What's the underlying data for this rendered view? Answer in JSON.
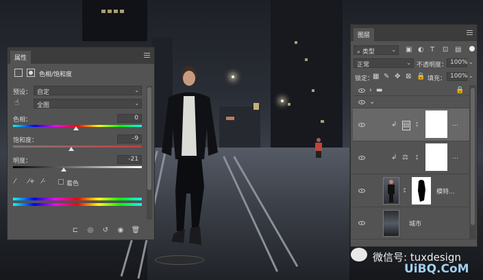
{
  "properties_panel": {
    "tab": "属性",
    "adjustment_title": "色相/饱和度",
    "preset_label": "预设：",
    "preset_value": "自定",
    "channel_value": "全图",
    "hue_label": "色相：",
    "hue_value": "0",
    "saturation_label": "饱和度：",
    "saturation_value": "-9",
    "lightness_label": "明度：",
    "lightness_value": "-21",
    "colorize_label": "着色"
  },
  "layers_panel": {
    "tab": "图层",
    "filter_value": "类型",
    "blend_mode": "正常",
    "opacity_label": "不透明度：",
    "opacity_value": "100%",
    "lock_label": "锁定：",
    "fill_label": "填充：",
    "fill_value": "100%",
    "layers": [
      {
        "name": "",
        "type": "group"
      },
      {
        "name": "",
        "type": "subgroup"
      },
      {
        "name": "…",
        "type": "hue-saturation-adjustment"
      },
      {
        "name": "…",
        "type": "color-balance-adjustment"
      },
      {
        "name": "模特…",
        "type": "pixel-with-mask"
      },
      {
        "name": "城市",
        "type": "pixel"
      }
    ]
  },
  "watermark": {
    "wechat": "微信号: tuxdesign",
    "site": "UiBQ.CoM"
  },
  "colors": {
    "panel_bg": "#535353",
    "panel_tab_bar": "#3c3c3c",
    "selected_row": "#686868"
  }
}
